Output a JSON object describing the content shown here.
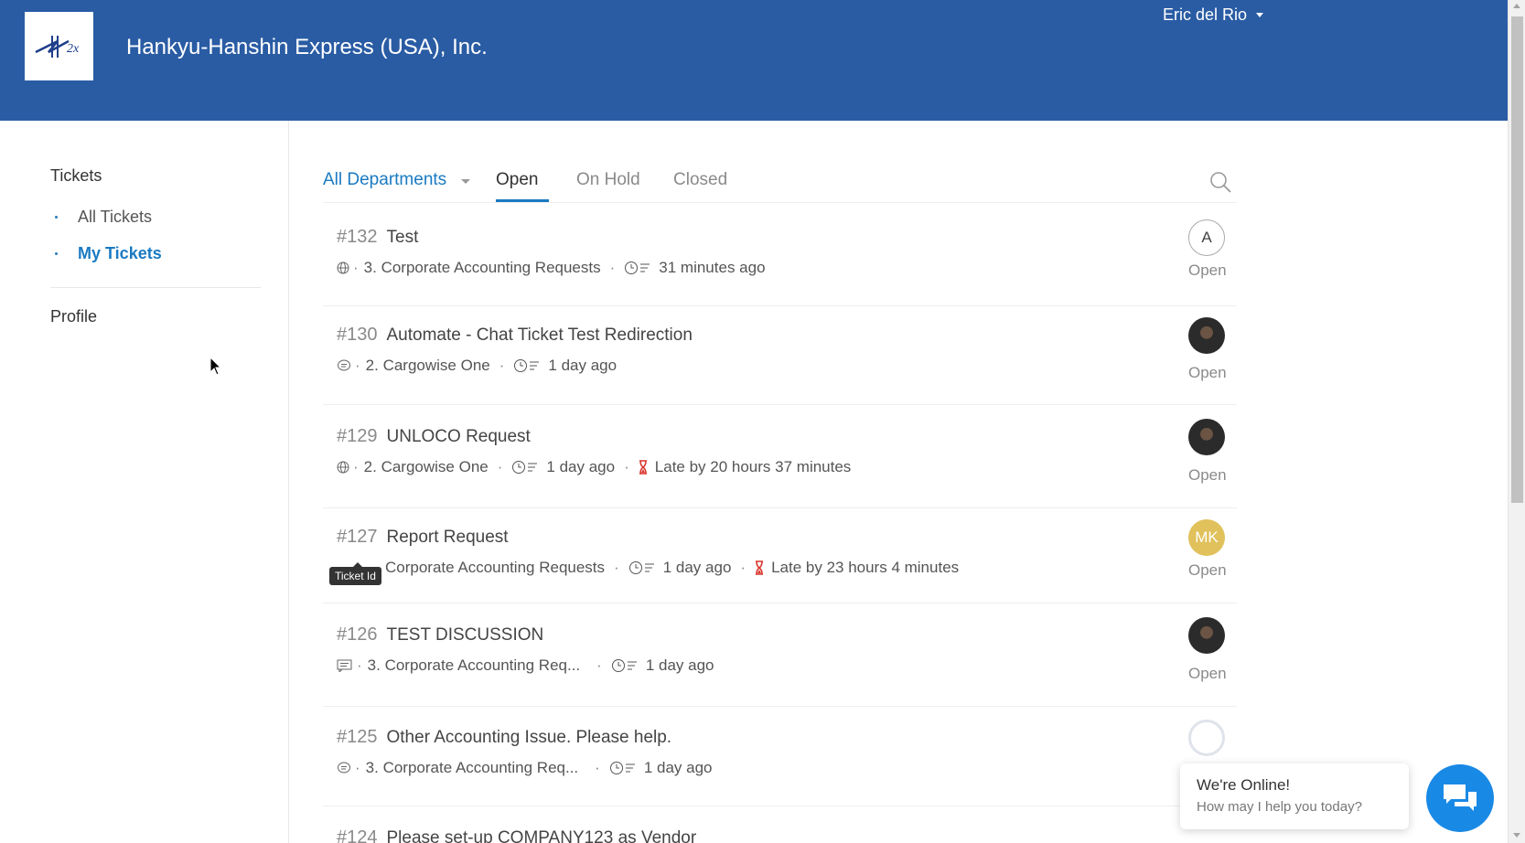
{
  "header": {
    "company": "Hankyu-Hanshin Express (USA), Inc.",
    "user": "Eric del Rio"
  },
  "sidebar": {
    "tickets_heading": "Tickets",
    "items": [
      {
        "label": "All Tickets"
      },
      {
        "label": "My Tickets"
      }
    ],
    "profile": "Profile"
  },
  "tabs": {
    "department": "All Departments",
    "open": "Open",
    "on_hold": "On Hold",
    "closed": "Closed"
  },
  "tickets": [
    {
      "id": "#132",
      "title": "Test",
      "department": "3. Corporate Accounting Requests",
      "time": "31 minutes ago",
      "late": "",
      "status": "Open",
      "avatar": "A",
      "channel": "web"
    },
    {
      "id": "#130",
      "title": "Automate - Chat Ticket Test Redirection",
      "department": "2. Cargowise One",
      "time": "1 day ago",
      "late": "",
      "status": "Open",
      "avatar": "",
      "channel": "chat"
    },
    {
      "id": "#129",
      "title": "UNLOCO Request",
      "department": "2. Cargowise One",
      "time": "1 day ago",
      "late": "Late by 20 hours 37 minutes",
      "status": "Open",
      "avatar": "",
      "channel": "web"
    },
    {
      "id": "#127",
      "title": "Report Request",
      "department": "Corporate Accounting Requests",
      "time": "1 day ago",
      "late": "Late by 23 hours 4 minutes",
      "status": "Open",
      "avatar": "MK",
      "channel": "web"
    },
    {
      "id": "#126",
      "title": "TEST DISCUSSION",
      "department": "3. Corporate Accounting Req...",
      "time": "1 day ago",
      "late": "",
      "status": "Open",
      "avatar": "",
      "channel": "forum"
    },
    {
      "id": "#125",
      "title": "Other Accounting Issue. Please help.",
      "department": "3. Corporate Accounting Req...",
      "time": "1 day ago",
      "late": "",
      "status": "Open",
      "avatar": "",
      "channel": "chat"
    },
    {
      "id": "#124",
      "title": "Please set-up COMPANY123 as Vendor"
    }
  ],
  "tooltip": "Ticket Id",
  "chat": {
    "title": "We're Online!",
    "subtitle": "How may I help you today?"
  },
  "colors": {
    "header_bg": "#2a5ca4",
    "accent": "#1a7ac2",
    "late": "#d9342b",
    "chat_button": "#1989e6"
  }
}
